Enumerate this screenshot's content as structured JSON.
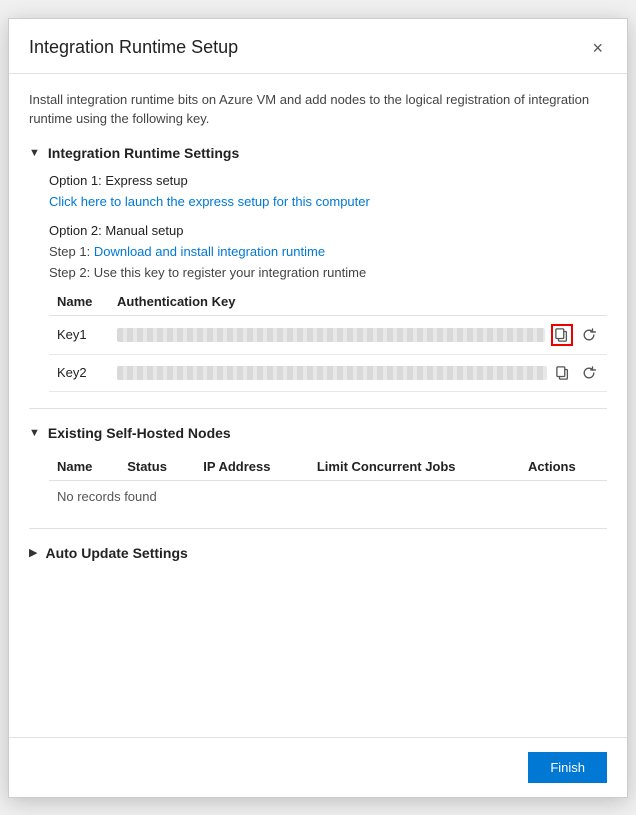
{
  "modal": {
    "title": "Integration Runtime Setup",
    "close_label": "×"
  },
  "intro": {
    "text": "Install integration runtime bits on Azure VM and add nodes to the logical registration of integration runtime using the following key."
  },
  "settings_section": {
    "title": "Integration Runtime Settings",
    "chevron": "▼",
    "option1": {
      "label": "Option 1: Express setup",
      "link_text": "Click here to launch the express setup for this computer",
      "link_href": "#"
    },
    "option2": {
      "label": "Option 2: Manual setup",
      "step1_text": "Step 1:",
      "step1_link": "Download and install integration runtime",
      "step1_href": "#",
      "step2_text": "Step 2: Use this key to register your integration runtime"
    },
    "table": {
      "col_name": "Name",
      "col_auth_key": "Authentication Key",
      "rows": [
        {
          "name": "Key1"
        },
        {
          "name": "Key2"
        }
      ]
    }
  },
  "nodes_section": {
    "title": "Existing Self-Hosted Nodes",
    "chevron": "▼",
    "columns": {
      "name": "Name",
      "status": "Status",
      "ip_address": "IP Address",
      "limit_jobs": "Limit Concurrent Jobs",
      "actions": "Actions"
    },
    "no_records": "No records found"
  },
  "auto_update_section": {
    "title": "Auto Update Settings",
    "chevron": "▶"
  },
  "footer": {
    "finish_label": "Finish"
  }
}
